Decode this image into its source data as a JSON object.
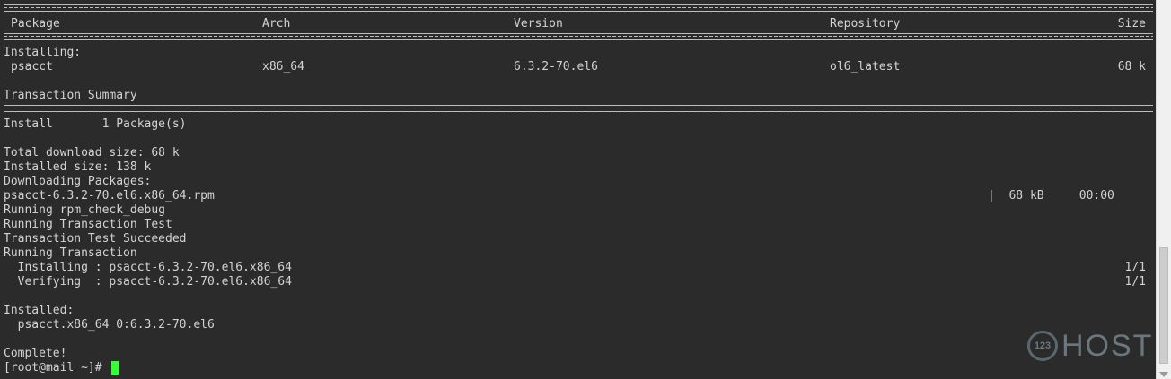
{
  "table": {
    "headers": {
      "package": "Package",
      "arch": "Arch",
      "version": "Version",
      "repository": "Repository",
      "size": "Size"
    },
    "section_label": "Installing:",
    "rows": [
      {
        "package": "psacct",
        "arch": "x86_64",
        "version": "6.3.2-70.el6",
        "repository": "ol6_latest",
        "size": "68 k"
      }
    ]
  },
  "summary": {
    "title": "Transaction Summary",
    "install_line": "Install       1 Package(s)"
  },
  "output": {
    "total_download": "Total download size: 68 k",
    "installed_size": "Installed size: 138 k",
    "downloading": "Downloading Packages:",
    "rpm_file": "psacct-6.3.2-70.el6.x86_64.rpm",
    "rpm_progress": "|  68 kB     00:00",
    "check_debug": "Running rpm_check_debug",
    "transaction_test": "Running Transaction Test",
    "test_succeeded": "Transaction Test Succeeded",
    "running_transaction": "Running Transaction",
    "installing_line": "  Installing : psacct-6.3.2-70.el6.x86_64",
    "installing_count": "1/1",
    "verifying_line": "  Verifying  : psacct-6.3.2-70.el6.x86_64",
    "verifying_count": "1/1",
    "installed_label": "Installed:",
    "installed_pkg": "  psacct.x86_64 0:6.3.2-70.el6",
    "complete": "Complete!",
    "prompt": "[root@mail ~]# "
  },
  "watermark": {
    "circle_text": "123",
    "brand": "HOST"
  },
  "colors": {
    "background": "#2b2b2b",
    "text": "#d3d3d3",
    "cursor": "#33ff33"
  }
}
